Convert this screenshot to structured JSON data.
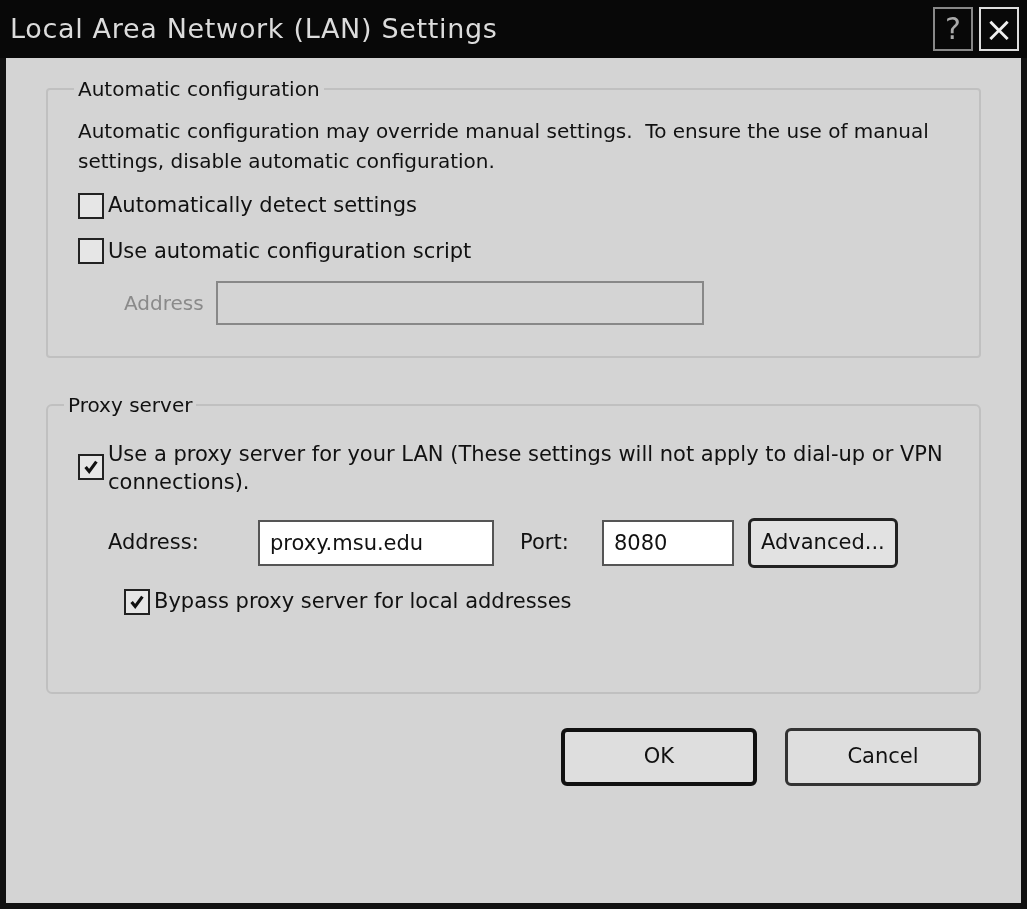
{
  "window": {
    "title": "Local Area Network (LAN) Settings",
    "title_buttons": [
      {
        "kind": "help",
        "label": "?"
      },
      {
        "kind": "close",
        "label": "×"
      }
    ]
  },
  "automatic_configuration": {
    "title": "Automatic configuration",
    "description": "Automatic configuration may override manual settings.  To ensure the use of manual settings, disable automatic configuration.",
    "checkboxes": [
      {
        "label": "Automatically detect settings",
        "checked": false
      },
      {
        "label": "Use automatic configuration script",
        "checked": false
      }
    ],
    "address": {
      "label": "Address",
      "disabled": true
    }
  },
  "proxy_server": {
    "title": "Proxy server",
    "use_proxy": {
      "label": "Use a proxy server for your LAN (These settings will not apply to dial-up or VPN connections).",
      "checked": true
    },
    "address": {
      "label": "Address:",
      "value": "proxy.msu.edu"
    },
    "port": {
      "label": "Port:",
      "value": "8080"
    },
    "advanced_button": "Advanced...",
    "bypass": {
      "label": "Bypass proxy server for local addresses",
      "checked": true
    }
  },
  "buttons": [
    {
      "label": "OK",
      "default": true
    },
    {
      "label": "Cancel",
      "default": false
    }
  ]
}
